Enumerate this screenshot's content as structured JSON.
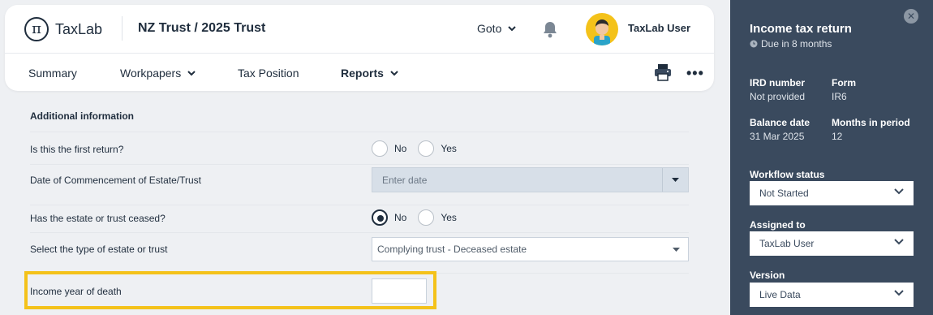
{
  "header": {
    "logo_text": "TaxLab",
    "logo_glyph": "π",
    "entity_title": "NZ Trust / 2025 Trust",
    "goto_label": "Goto",
    "user_name": "TaxLab User"
  },
  "nav": {
    "items": [
      {
        "label": "Summary"
      },
      {
        "label": "Workpapers"
      },
      {
        "label": "Tax Position"
      },
      {
        "label": "Reports"
      }
    ],
    "more_label": "•••"
  },
  "form": {
    "section_title": "Additional information",
    "first_return": {
      "label": "Is this the first return?",
      "no": "No",
      "yes": "Yes"
    },
    "commencement": {
      "label": "Date of Commencement of Estate/Trust",
      "placeholder": "Enter date"
    },
    "ceased": {
      "label": "Has the estate or trust ceased?",
      "no": "No",
      "yes": "Yes",
      "selected": "No"
    },
    "estate_type": {
      "label": "Select the type of estate or trust",
      "value": "Complying trust - Deceased estate"
    },
    "income_year": {
      "label": "Income year of death",
      "value": ""
    }
  },
  "sidebar": {
    "title": "Income tax return",
    "due": "Due in 8 months",
    "ird_label": "IRD number",
    "ird_value": "Not provided",
    "form_label": "Form",
    "form_value": "IR6",
    "balance_label": "Balance date",
    "balance_value": "31 Mar 2025",
    "months_label": "Months in period",
    "months_value": "12",
    "workflow_label": "Workflow status",
    "workflow_value": "Not Started",
    "assigned_label": "Assigned to",
    "assigned_value": "TaxLab User",
    "version_label": "Version",
    "version_value": "Live Data",
    "close_glyph": "✕"
  },
  "colors": {
    "accent": "#f4c21a",
    "sidebar": "#3a4a5e",
    "text": "#1f2d3d"
  }
}
